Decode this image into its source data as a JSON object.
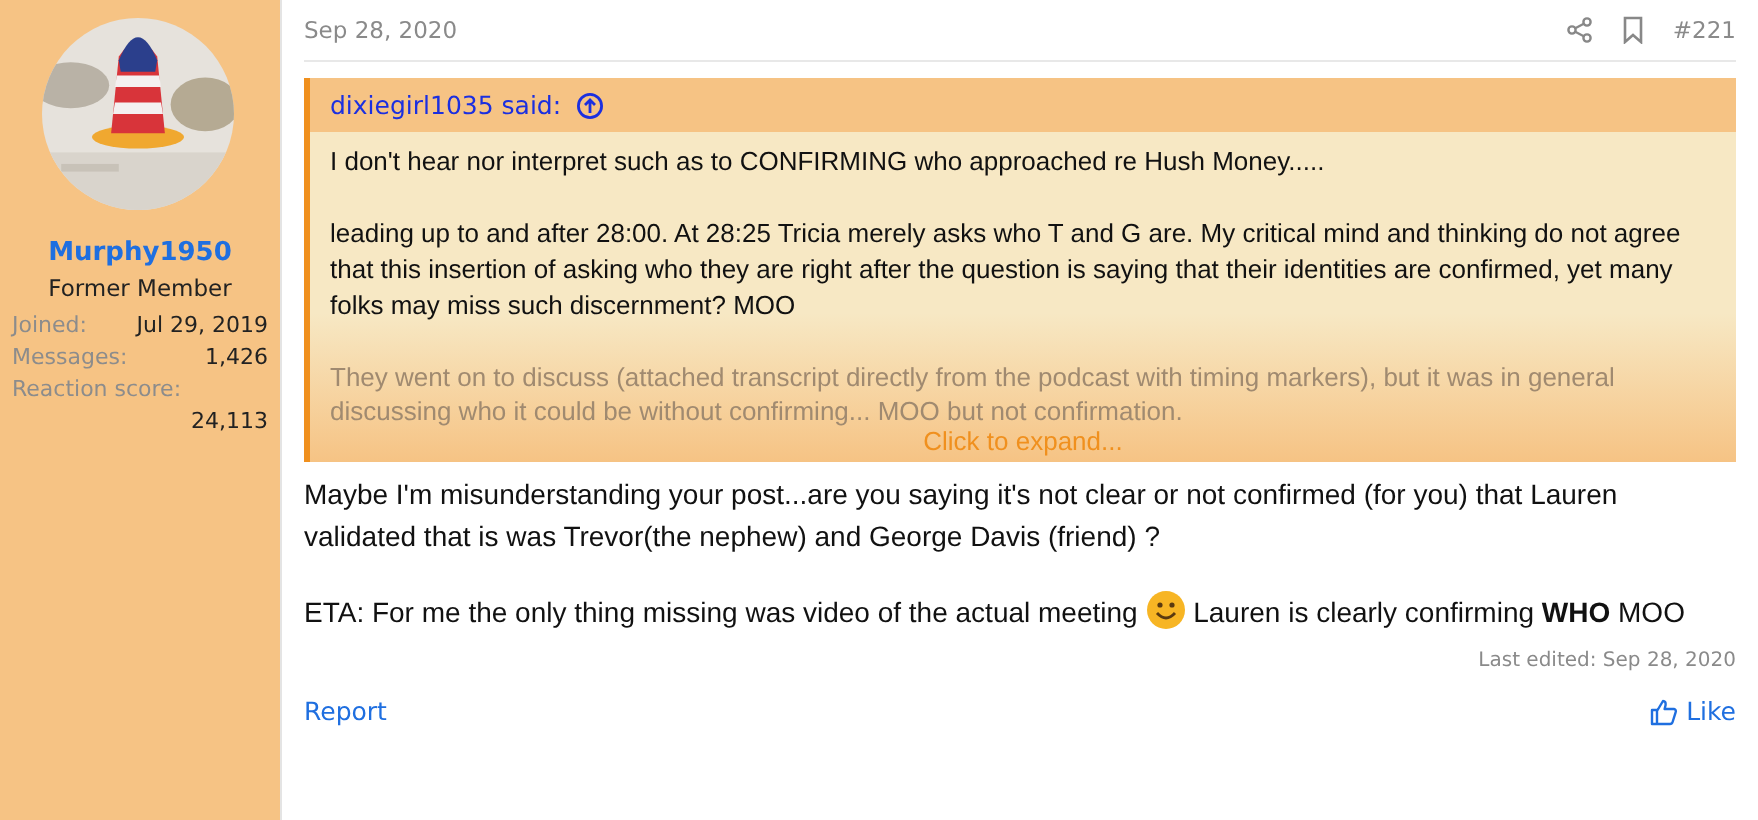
{
  "user": {
    "name": "Murphy1950",
    "title": "Former Member",
    "stats": [
      {
        "label": "Joined:",
        "value": "Jul 29, 2019"
      },
      {
        "label": "Messages:",
        "value": "1,426"
      },
      {
        "label": "Reaction score:",
        "value": "24,113"
      }
    ]
  },
  "post": {
    "date": "Sep 28, 2020",
    "number": "#221",
    "quote": {
      "author": "dixiegirl1035 said:",
      "paragraphs": [
        "I don't hear nor interpret such as to CONFIRMING who approached re Hush Money.....",
        "leading up to and after 28:00. At 28:25 Tricia merely asks who T and G are. My critical mind and thinking do not agree that this insertion of asking who they are right after the question is saying that their identities are confirmed, yet many folks may miss such discernment? MOO"
      ],
      "faded": "They went on to discuss (attached transcript directly from the podcast with timing markers), but it was in general discussing who it could be without confirming... MOO but not confirmation.",
      "expand": "Click to expand..."
    },
    "message": "Maybe I'm misunderstanding your post...are you saying it's not clear or not confirmed (for you) that Lauren validated that is was Trevor(the nephew) and George Davis (friend) ?",
    "eta_before": "ETA: For me the only thing missing was video of the actual meeting",
    "eta_after": "Lauren is clearly confirming **WHO** MOO",
    "last_edited": "Last edited: Sep 28, 2020",
    "report": "Report",
    "like": "Like"
  }
}
